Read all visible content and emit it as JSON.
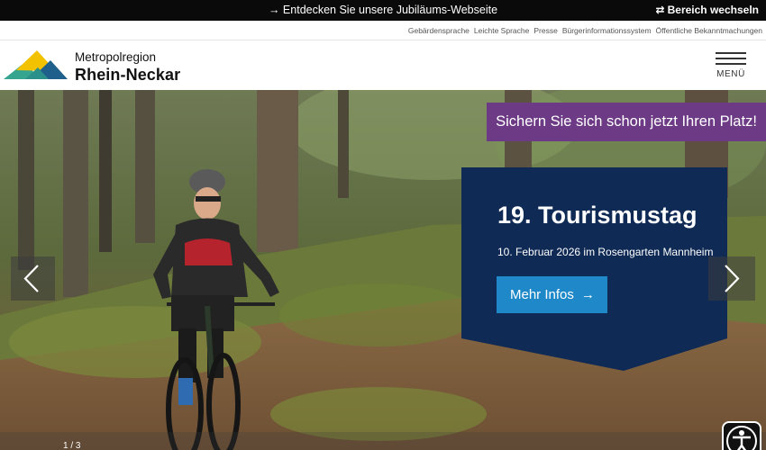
{
  "topbar": {
    "promo": "→ Entdecken Sie unsere Jubiläums-Webseite",
    "switch_icon": "swap-arrows-icon",
    "switch_label": "Bereich wechseln"
  },
  "utility_links": [
    "Gebärdensprache",
    "Leichte Sprache",
    "Presse",
    "Bürgerinformationssystem",
    "Öffentliche Bekanntmachungen"
  ],
  "brand": {
    "line1": "Metropolregion",
    "line2": "Rhein-Neckar",
    "logo_colors": [
      "#f2c200",
      "#35a58f",
      "#1f5f8b"
    ]
  },
  "menu": {
    "label": "MENÜ"
  },
  "hero": {
    "banner": "Sichern Sie sich schon jetzt Ihren Platz!",
    "card": {
      "title": "19. Tourismustag",
      "subtitle": "10. Februar 2026 im Rosengarten Mannheim",
      "button_label": "Mehr Infos",
      "button_arrow": "→"
    },
    "pager": "1 / 3"
  },
  "colors": {
    "banner": "#6d3a86",
    "card": "#0f2a55",
    "button": "#1e88c8"
  }
}
